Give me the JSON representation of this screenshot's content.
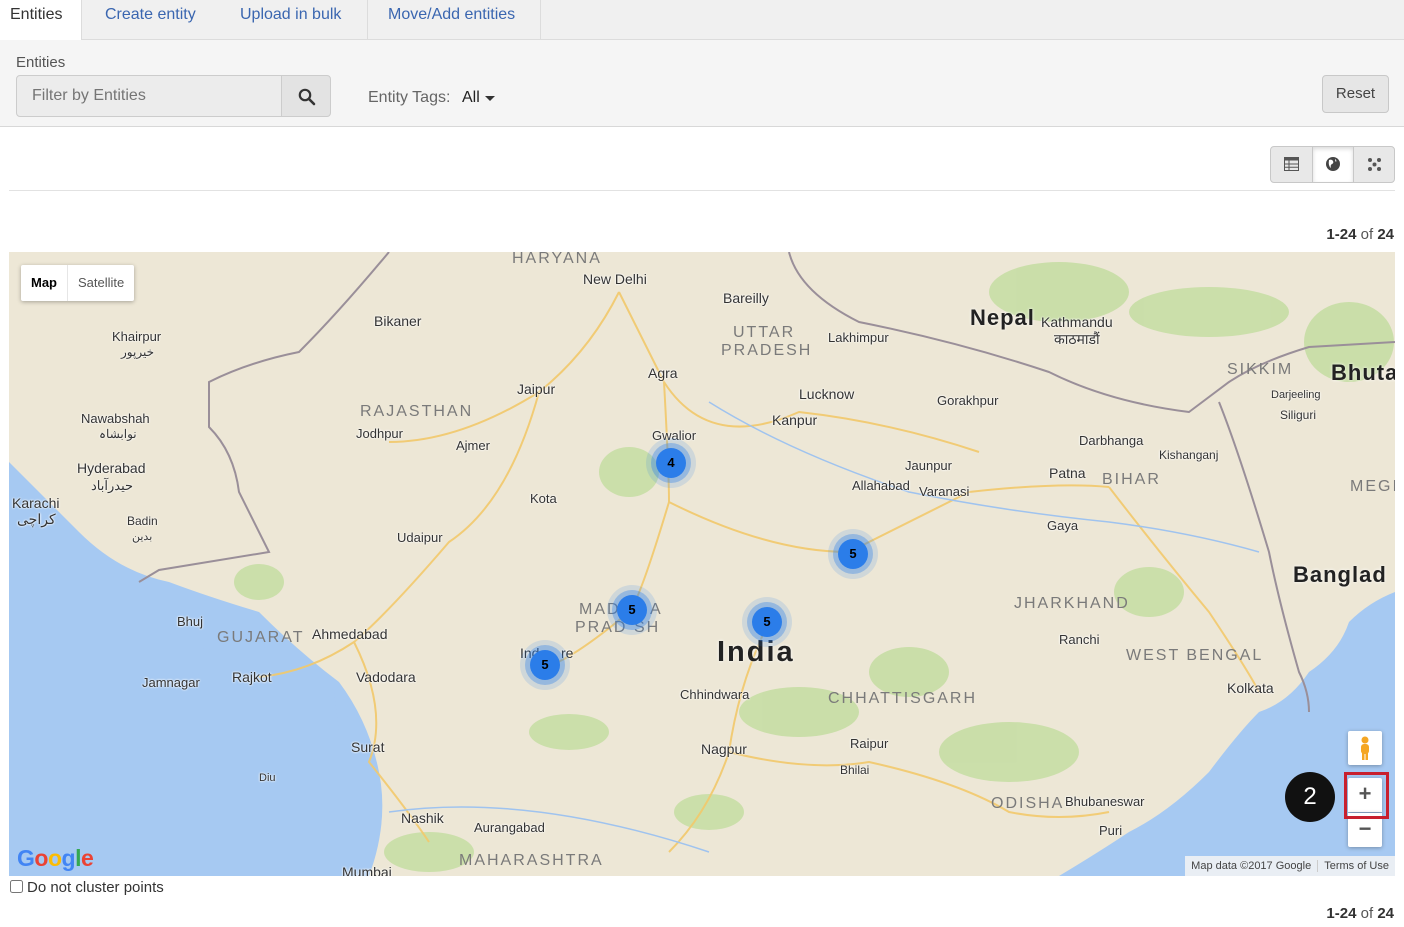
{
  "tabs": [
    {
      "label": "Entities",
      "active": true
    },
    {
      "label": "Create entity",
      "active": false
    },
    {
      "label": "Upload in bulk",
      "active": false
    },
    {
      "label": "Move/Add entities",
      "active": false
    }
  ],
  "filter": {
    "section_label": "Entities",
    "placeholder": "Filter by Entities",
    "tags_label": "Entity Tags:",
    "tags_value": "All",
    "reset_label": "Reset"
  },
  "views": [
    {
      "name": "table-view",
      "icon": "table-icon",
      "active": false
    },
    {
      "name": "map-view",
      "icon": "globe-icon",
      "active": true
    },
    {
      "name": "scatter-view",
      "icon": "scatter-icon",
      "active": false
    }
  ],
  "pager": {
    "range": "1-24",
    "of_word": "of",
    "total": "24"
  },
  "map": {
    "type_controls": {
      "map": "Map",
      "satellite": "Satellite"
    },
    "countries": {
      "nepal": "Nepal",
      "bhutan": "Bhuta",
      "bangladesh": "Banglad",
      "india": "India"
    },
    "states": {
      "haryana": "HARYANA",
      "uttar": "UTTAR",
      "pradesh": "PRADESH",
      "rajasthan": "RAJASTHAN",
      "sikkim": "SIKKIM",
      "bihar": "BIHAR",
      "meghalaya": "MEGI",
      "jharkhand": "JHARKHAND",
      "madhya1": "MAD",
      "madhya2": "A",
      "madhya3": "PRAD",
      "madhya4": "SH",
      "gujarat": "GUJARAT",
      "west_bengal": "WEST BENGAL",
      "chhattisgarh": "CHHATTISGARH",
      "odisha": "ODISHA",
      "maharashtra": "MAHARASHTRA"
    },
    "places": {
      "new_delhi": "New Delhi",
      "bareilly": "Bareilly",
      "bikaner": "Bikaner",
      "lakhimpur": "Lakhimpur",
      "kathmandu": "Kathmandu",
      "kathmandu_local": "काठमाडौं",
      "khairpur": "Khairpur",
      "khairpur_local": "خیرپور",
      "agra": "Agra",
      "jaipur": "Jaipur",
      "lucknow": "Lucknow",
      "gorakhpur": "Gorakhpur",
      "darjeeling": "Darjeeling",
      "siliguri": "Siliguri",
      "nawabshah": "Nawabshah",
      "nawabshah_local": "نوابشاہ",
      "jodhpur": "Jodhpur",
      "ajmer": "Ajmer",
      "kanpur": "Kanpur",
      "gwalior": "Gwalior",
      "darbhanga": "Darbhanga",
      "kishanganj": "Kishanganj",
      "hyderabad": "Hyderabad",
      "hyderabad_local": "حیدرآباد",
      "jaunpur": "Jaunpur",
      "allahabad": "Allahabad",
      "varanasi": "Varanasi",
      "patna": "Patna",
      "karachi": "Karachi",
      "karachi_local": "کراچی",
      "kota": "Kota",
      "badin": "Badin",
      "badin_local": "بدين",
      "gaya": "Gaya",
      "udaipur": "Udaipur",
      "bhuj": "Bhuj",
      "ahmedabad": "Ahmedabad",
      "ranchi": "Ranchi",
      "indore1": "Ind",
      "indore2": "re",
      "jamnagar": "Jamnagar",
      "rajkot": "Rajkot",
      "vadodara": "Vadodara",
      "kolkata": "Kolkata",
      "chhindwara": "Chhindwara",
      "surat": "Surat",
      "nagpur": "Nagpur",
      "raipur": "Raipur",
      "bhilai": "Bhilai",
      "diu": "Diu",
      "bhubaneswar": "Bhubaneswar",
      "nashik": "Nashik",
      "aurangabad": "Aurangabad",
      "puri": "Puri",
      "mumbai": "Mumbai"
    },
    "clusters": [
      {
        "count": "4"
      },
      {
        "count": "5"
      },
      {
        "count": "5"
      },
      {
        "count": "5"
      },
      {
        "count": "5"
      }
    ],
    "zoom_in": "+",
    "zoom_out": "−",
    "callout": "2",
    "logo": "Google",
    "attribution": {
      "data": "Map data ©2017 Google",
      "terms": "Terms of Use"
    }
  },
  "cluster_option": "Do not cluster points",
  "colors": {
    "link": "#3a66b0",
    "cluster": "#2b7de9",
    "highlight": "#c8202e",
    "water": "#a6c9f2"
  }
}
